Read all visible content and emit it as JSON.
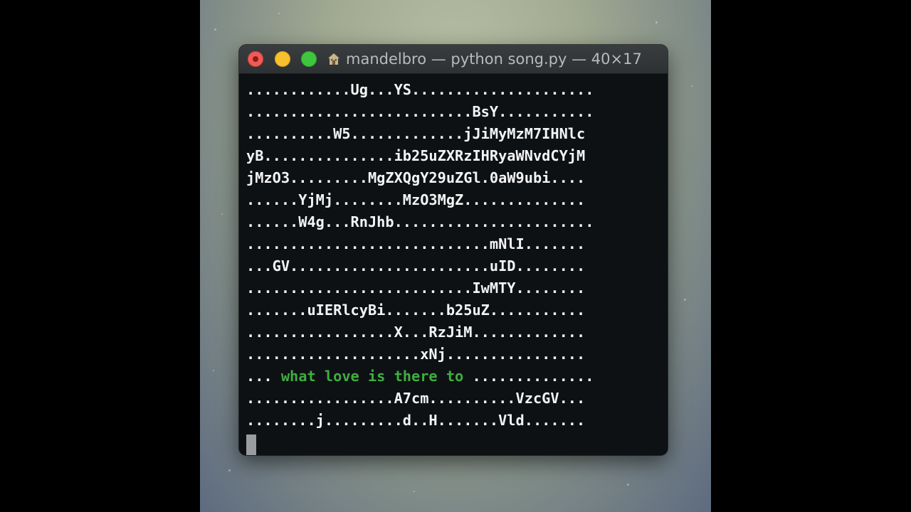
{
  "window": {
    "title": "mandelbro — python song.py — 40×17",
    "title_icon": "home-folder-icon",
    "controls": [
      "close-icon",
      "minimize-icon",
      "maximize-icon"
    ]
  },
  "terminal": {
    "lines": [
      "............Ug...YS.....................",
      "..........................BsY...........",
      "..........W5.............jJiMyMzM7IHNlc",
      "yB...............ib25uZXRzIHRyaWNvdCYjM",
      "jMzO3.........MgZXQgY29uZGl.0aW9ubi....",
      "......YjMj........MzO3MgZ..............",
      "......W4g...RnJhb.......................",
      "............................mNlI.......",
      "...GV.......................uID........",
      "..........................IwMTY........",
      ".......uIERlcyBi.......b25uZ...........",
      ".................X...RzJiM.............",
      "....................xNj................",
      "...",
      ".................A7cm..........VzcGV...",
      "........j.........d..H.......Vld.......",
      ""
    ],
    "highlight": {
      "line_index": 13,
      "prefix": "... ",
      "text": "what love is there to",
      "suffix": " .............."
    },
    "colors": {
      "foreground": "#f4f4f4",
      "highlight": "#3fae3f",
      "background": "#0d1114"
    }
  }
}
